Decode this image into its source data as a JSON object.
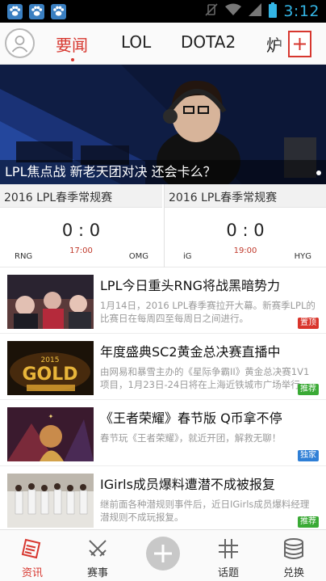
{
  "status_bar": {
    "time": "3:12",
    "notification_icons": [
      "paw-icon",
      "paw-icon",
      "paw-icon"
    ]
  },
  "tabs": [
    {
      "label": "要闻",
      "active": true
    },
    {
      "label": "LOL",
      "active": false
    },
    {
      "label": "DOTA2",
      "active": false
    },
    {
      "label": "炉",
      "active": false
    }
  ],
  "banner": {
    "caption": "LPL焦点战 新老天团对决 还会卡么？"
  },
  "matches": [
    {
      "league": "2016 LPL春季常规赛",
      "score": "0 : 0",
      "time": "17:00",
      "home": "RNG",
      "away": "OMG"
    },
    {
      "league": "2016 LPL春季常规赛",
      "score": "0 : 0",
      "time": "19:00",
      "home": "iG",
      "away": "HYG"
    }
  ],
  "news": [
    {
      "title": "LPL今日重头RNG将战黑暗势力",
      "desc": "1月14日，2016 LPL春季赛拉开大幕。新赛季LPL的比赛日在每周四至每周日之间进行。",
      "tag": "置顶",
      "tag_color": "#d9342b"
    },
    {
      "title": "年度盛典SC2黄金总决赛直播中",
      "desc": "由网易和暴雪主办的《星际争霸II》黄金总决赛1V1项目，1月23日-24日将在上海近铁城市广场举行。",
      "tag": "推荐",
      "tag_color": "#3aaa35"
    },
    {
      "title": "《王者荣耀》春节版 Q币拿不停",
      "desc": "春节玩《王者荣耀》，就近开团，解救无聊！",
      "tag": "独家",
      "tag_color": "#2f7fd6"
    },
    {
      "title": "IGirls成员爆料遭潜不成被报复",
      "desc": "继前面各种潜规则事件后，近日IGirls成员爆料经理潜规则不成玩报复。",
      "tag": "推荐",
      "tag_color": "#3aaa35"
    }
  ],
  "bottom_nav": [
    {
      "label": "资讯",
      "icon": "news-icon",
      "active": true
    },
    {
      "label": "赛事",
      "icon": "crossed-swords-icon",
      "active": false
    },
    {
      "label": "",
      "icon": "plus-icon",
      "active": false
    },
    {
      "label": "话题",
      "icon": "hashtag-icon",
      "active": false
    },
    {
      "label": "兑换",
      "icon": "coins-icon",
      "active": false
    }
  ],
  "colors": {
    "accent": "#d7372f",
    "status_time": "#33b5e5"
  }
}
